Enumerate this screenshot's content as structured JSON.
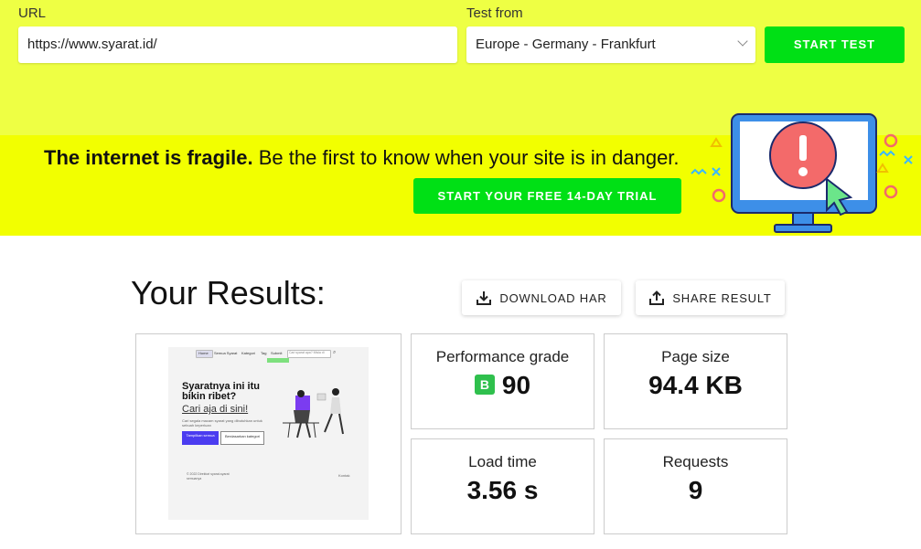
{
  "form": {
    "url_label": "URL",
    "url_value": "https://www.syarat.id/",
    "location_label": "Test from",
    "location_value": "Europe - Germany - Frankfurt",
    "start_button": "START TEST"
  },
  "banner": {
    "headline_bold": "The internet is fragile.",
    "headline_rest": "Be the first to know when your site is in danger.",
    "trial_button": "START YOUR FREE 14-DAY TRIAL"
  },
  "results": {
    "title": "Your Results:",
    "download_har": "DOWNLOAD HAR",
    "share_result": "SHARE RESULT"
  },
  "metrics": {
    "performance_label": "Performance grade",
    "performance_grade": "B",
    "performance_score": "90",
    "page_size_label": "Page size",
    "page_size_value": "94.4 KB",
    "load_time_label": "Load time",
    "load_time_value": "3.56 s",
    "requests_label": "Requests",
    "requests_value": "9"
  },
  "thumbnail": {
    "nav_items": [
      "Home",
      "Semua Syarat",
      "Kategori",
      "Tag",
      "Submit"
    ],
    "search_placeholder": "Cari syarat apa? Misla di",
    "hero_title_line1": "Syaratnya ini itu",
    "hero_title_line2": "bikin ribet?",
    "hero_subtitle": "Cari aja di sini!",
    "hero_desc": "Cari segala macam syarat yang dibutuhkan untuk sebuah keperluan",
    "btn_primary": "Tampilkan semua",
    "btn_secondary": "Berdasarkan kategori",
    "footer_left": "© 2022 Direktori syarat-syarat semuanya",
    "footer_right": "Kontak"
  },
  "colors": {
    "top_bg": "#eeff44",
    "banner_bg": "#f2ff00",
    "accent_green": "#00e015",
    "grade_green": "#2fc04d"
  }
}
